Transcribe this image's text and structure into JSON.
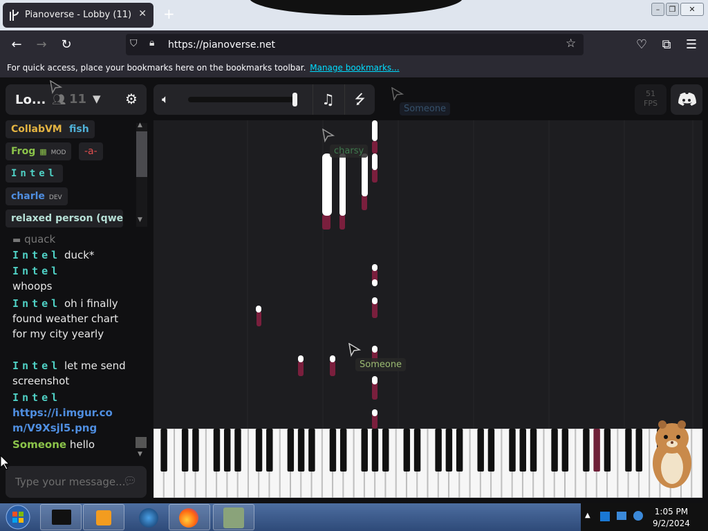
{
  "browser": {
    "tab_title": "Pianoverse - Lobby (11)",
    "tab_close": "✕",
    "new_tab": "+",
    "url": "https://pianoverse.net",
    "bookmarks_text": "For quick access, place your bookmarks here on the bookmarks toolbar.",
    "bookmarks_link": "Manage bookmarks..."
  },
  "room": {
    "name": "Lo...",
    "user_count": "11"
  },
  "toolbar": {
    "fps_value": "51",
    "fps_label": "FPS"
  },
  "users": [
    {
      "name": "CollabVM",
      "color": "#e3b341"
    },
    {
      "name": "fish",
      "color": "#4fb0d6"
    },
    {
      "name": "Frog",
      "badge": "MOD",
      "color": "#8bc34a"
    },
    {
      "name": "-a-",
      "color": "#e04e4e"
    },
    {
      "name": "Intel",
      "color": "#4fd1c5"
    },
    {
      "name": "charle",
      "badge": "DEV",
      "color": "#4f8ee0"
    },
    {
      "name": "relaxed person (qwer...",
      "color": "#b6e0d6"
    }
  ],
  "chat": {
    "messages": [
      {
        "author": "",
        "text": "quack"
      },
      {
        "author": "Intel",
        "text": "duck*"
      },
      {
        "author": "Intel",
        "text": "whoops"
      },
      {
        "author": "Intel",
        "text": "oh i finally found weather chart for my city yearly"
      },
      {
        "author": "Intel",
        "text": "let me send screenshot"
      },
      {
        "author": "Intel",
        "text": "https://i.imgur.com/V9Xsjl5.png"
      },
      {
        "author": "Someone",
        "text": "hello"
      }
    ],
    "input_placeholder": "Type your message..."
  },
  "cursors": [
    {
      "name": "Someone"
    },
    {
      "name": "charsy"
    },
    {
      "name": "Someone"
    }
  ],
  "taskbar": {
    "time": "1:05 PM",
    "date": "9/2/2024"
  },
  "colors": {
    "accent": "#4fd1c5",
    "note": "#ffffff",
    "trail": "#7a1f3d"
  }
}
